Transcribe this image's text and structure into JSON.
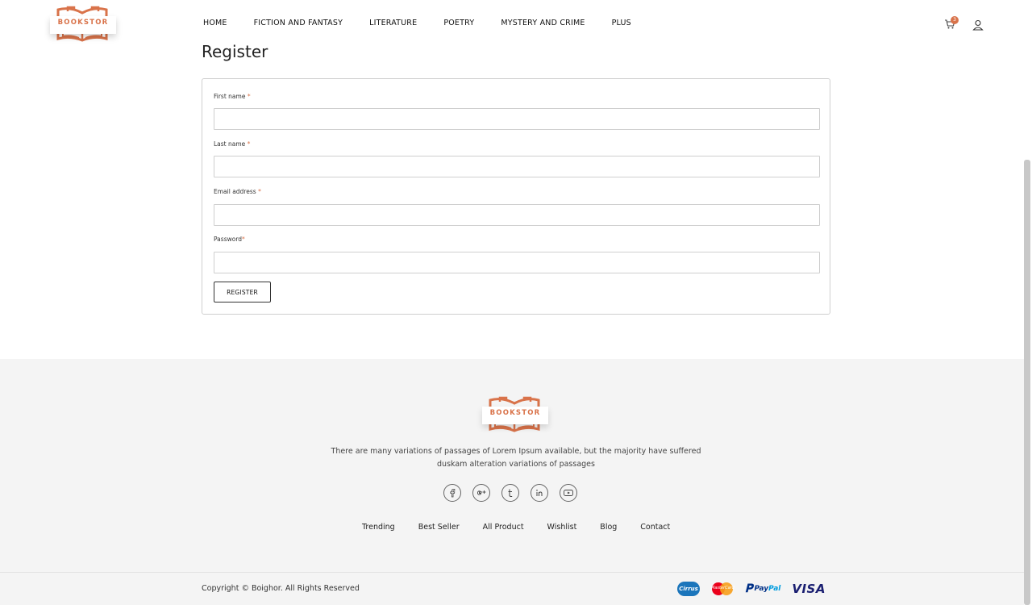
{
  "brand": {
    "logo_text": "BOOKSTOR",
    "accent_color": "#d9734a"
  },
  "nav": {
    "items": [
      "HOME",
      "FICTION AND FANTASY",
      "LITERATURE",
      "POETRY",
      "MYSTERY AND CRIME",
      "PLUS"
    ]
  },
  "header": {
    "cart_count": "3",
    "cart_icon": "cart-icon",
    "user_icon": "user-icon"
  },
  "main": {
    "title": "Register",
    "fields": [
      {
        "label": "First name",
        "required_mark": "*",
        "value": ""
      },
      {
        "label": "Last name",
        "required_mark": "*",
        "value": ""
      },
      {
        "label": "Email address",
        "required_mark": "*",
        "value": ""
      },
      {
        "label": "Password",
        "required_mark": "*",
        "value": ""
      }
    ],
    "submit_label": "REGISTER"
  },
  "footer": {
    "logo_text": "BOOKSTOR",
    "description": "There are many variations of passages of Lorem Ipsum available, but the majority have suffered duskam alteration variations of passages",
    "social": [
      "facebook-icon",
      "google-plus-icon",
      "tumblr-icon",
      "linkedin-icon",
      "youtube-icon"
    ],
    "links": [
      "Trending",
      "Best Seller",
      "All Product",
      "Wishlist",
      "Blog",
      "Contact"
    ],
    "copyright": "Copyright © Boighor. All Rights Reserved",
    "payments": {
      "cirrus": "Cirrus",
      "mastercard": "MasterCard",
      "paypal_a": "Pay",
      "paypal_b": "Pal",
      "visa": "VISA"
    }
  }
}
